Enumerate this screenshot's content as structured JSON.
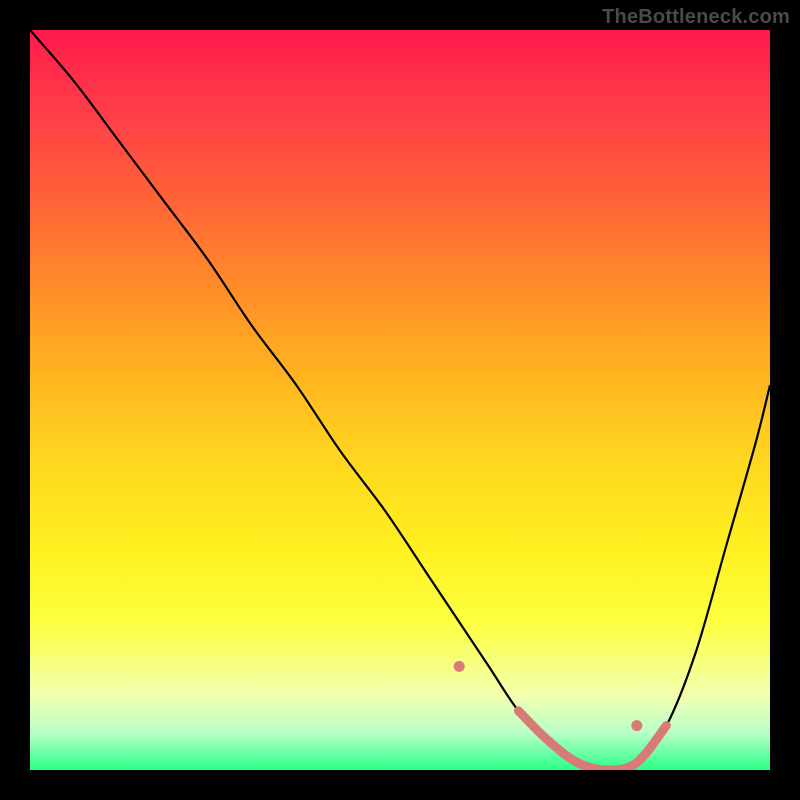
{
  "watermark": "TheBottleneck.com",
  "chart_data": {
    "type": "line",
    "title": "",
    "xlabel": "",
    "ylabel": "",
    "xlim": [
      0,
      100
    ],
    "ylim": [
      0,
      100
    ],
    "grid": false,
    "series": [
      {
        "name": "bottleneck-curve",
        "x": [
          0,
          6,
          12,
          18,
          24,
          30,
          36,
          42,
          48,
          54,
          58,
          62,
          66,
          70,
          74,
          78,
          82,
          86,
          90,
          94,
          98,
          100
        ],
        "y": [
          100,
          93,
          85,
          77,
          69,
          60,
          52,
          43,
          35,
          26,
          20,
          14,
          8,
          4,
          1,
          0,
          1,
          6,
          16,
          30,
          44,
          52
        ]
      }
    ],
    "highlight": {
      "color": "#d97a78",
      "points_index_range": [
        12,
        17
      ],
      "dots": [
        {
          "x": 58,
          "y": 14
        },
        {
          "x": 82,
          "y": 6
        }
      ]
    },
    "background_gradient_stops": [
      {
        "pos": 0.0,
        "color": "#ff1a4b"
      },
      {
        "pos": 0.5,
        "color": "#ffd620"
      },
      {
        "pos": 0.95,
        "color": "#b8ffc8"
      },
      {
        "pos": 1.0,
        "color": "#2aff85"
      }
    ]
  }
}
